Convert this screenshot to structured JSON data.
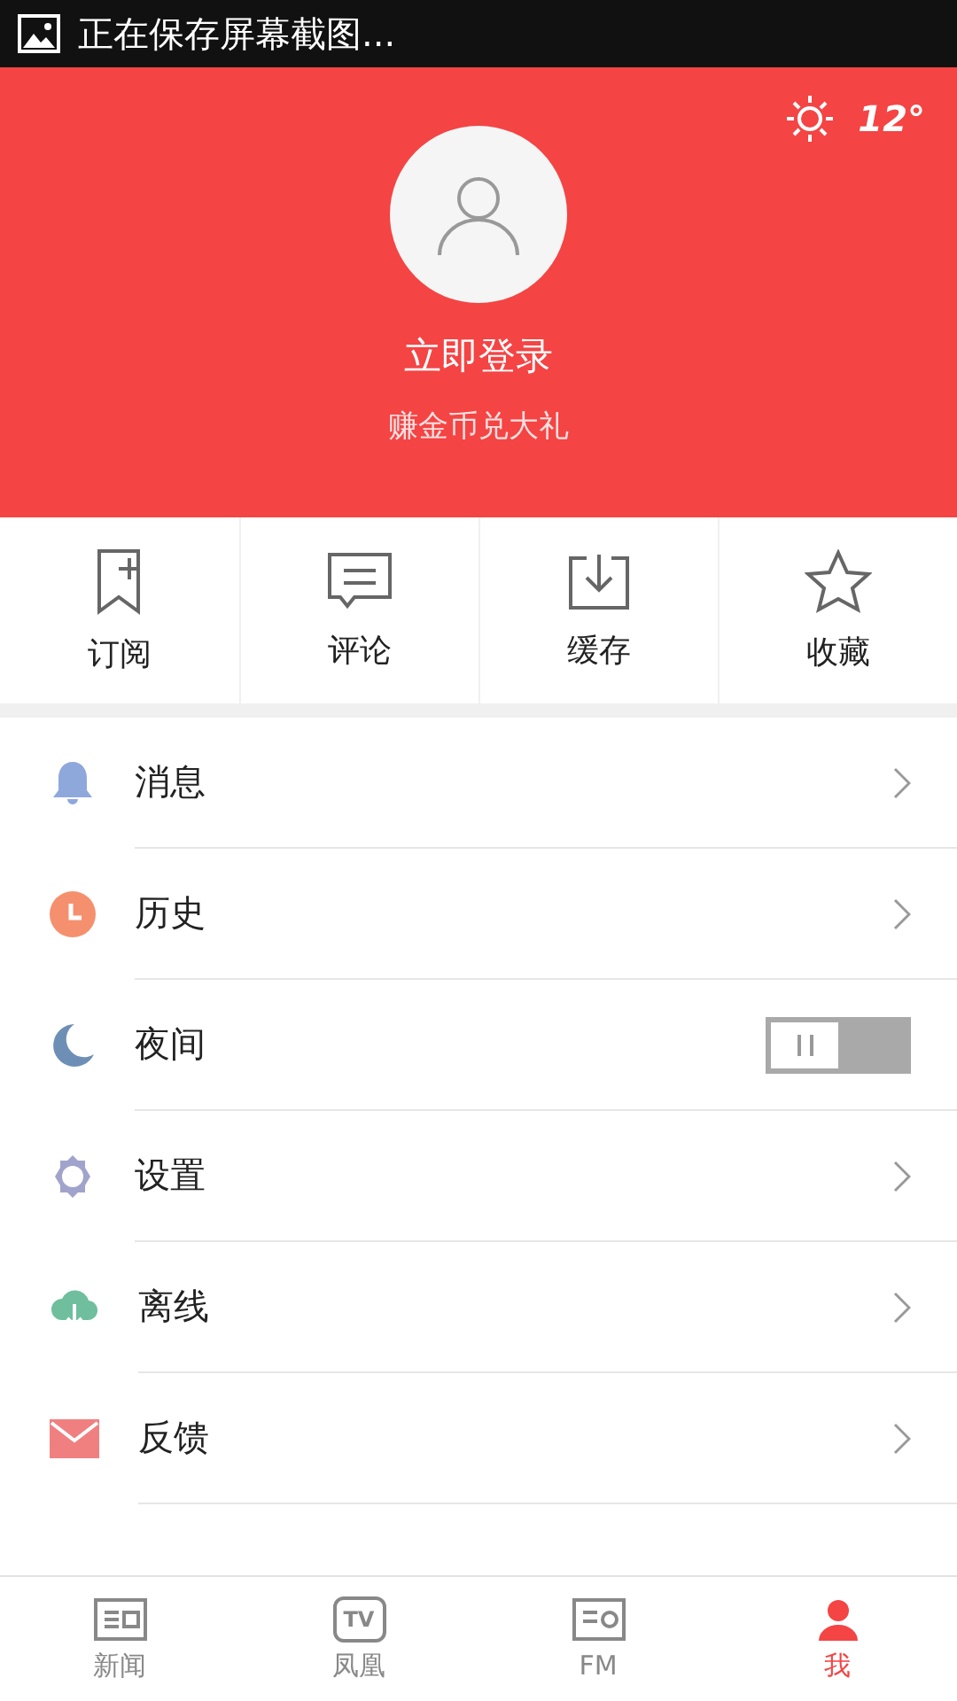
{
  "status_bar": {
    "text": "正在保存屏幕截图..."
  },
  "weather": {
    "temperature": "12°"
  },
  "profile": {
    "login": "立即登录",
    "subtitle": "赚金币兑大礼"
  },
  "shortcuts": [
    "订阅",
    "评论",
    "缓存",
    "收藏"
  ],
  "menu": [
    {
      "label": "消息",
      "kind": "arrow"
    },
    {
      "label": "历史",
      "kind": "arrow"
    },
    {
      "label": "夜间",
      "kind": "toggle",
      "on": false
    },
    {
      "label": "设置",
      "kind": "arrow"
    },
    {
      "label": "离线",
      "kind": "arrow"
    },
    {
      "label": "反馈",
      "kind": "arrow"
    }
  ],
  "tabs": [
    {
      "label": "新闻",
      "selected": false
    },
    {
      "label": "凤凰",
      "selected": false,
      "icon_text": "TV"
    },
    {
      "label": "FM",
      "selected": false
    },
    {
      "label": "我",
      "selected": true
    }
  ]
}
